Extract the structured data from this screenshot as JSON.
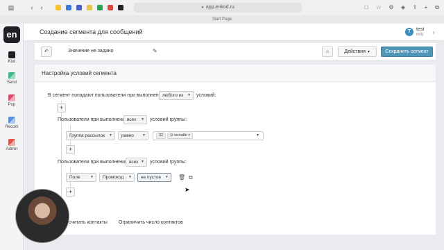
{
  "browser": {
    "url": "app.enkod.ru",
    "start_page": "Start Page"
  },
  "sidebar": {
    "logo": "en",
    "items": [
      {
        "label": "Kod",
        "color": "#1f1f25"
      },
      {
        "label": "Send",
        "color": "#47b58a"
      },
      {
        "label": "Pop",
        "color": "#d94b6d"
      },
      {
        "label": "Recom",
        "color": "#5a8fd8"
      },
      {
        "label": "Admin",
        "color": "#e0554a"
      }
    ]
  },
  "header": {
    "title": "Создание сегмента для сообщений",
    "user": {
      "initial": "T",
      "name": "test",
      "subtitle": "testy"
    }
  },
  "toolbar": {
    "back_icon": "undo-icon",
    "name_value": "Значение не задано",
    "actions_label": "Действия",
    "save_label": "Сохранить сегмент"
  },
  "card": {
    "title": "Настройка условий сегмента",
    "intro_prefix": "В сегмент попадают пользователи при выполнении",
    "intro_select": "любого из",
    "intro_suffix": "условий:",
    "groups": [
      {
        "prefix": "Пользователи при выполнении",
        "select": "всех",
        "suffix": "условий группы:",
        "condition": {
          "field": "Группа рассылок",
          "operator": "равно",
          "chip_count": "32",
          "chip_label": "онлайн"
        }
      },
      {
        "prefix": "Пользователи при выполнении",
        "select": "всех",
        "suffix": "условий группы:",
        "condition": {
          "field": "Поле",
          "operator": "Промокод",
          "value": "не пустое"
        }
      }
    ],
    "footer": {
      "count_link": "Посчитать контакты",
      "limit_link": "Ограничить число контактов"
    }
  }
}
